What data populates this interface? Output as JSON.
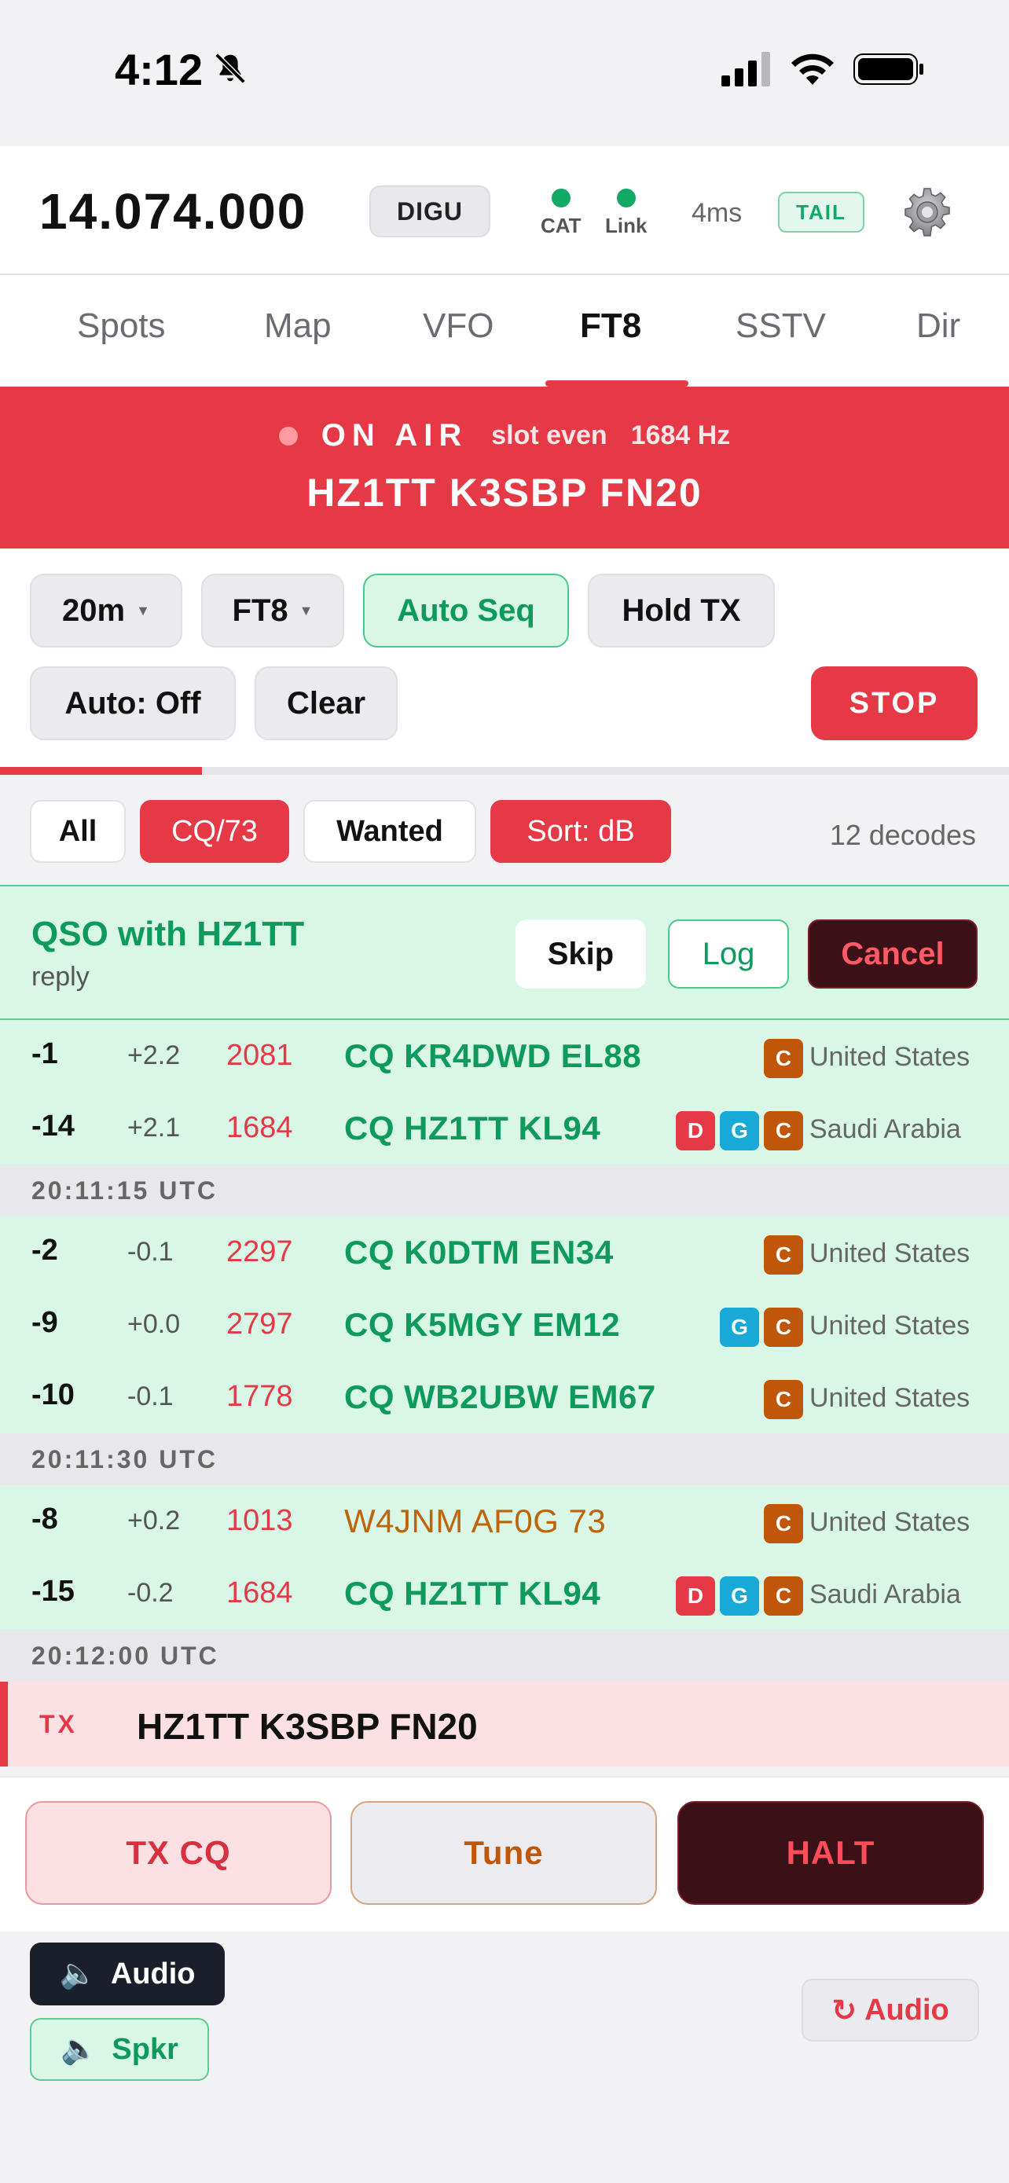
{
  "status_bar": {
    "time": "4:12"
  },
  "header": {
    "frequency": "14.074.000",
    "mode": "DIGU",
    "indicators": [
      {
        "label": "CAT",
        "color": "#12a866"
      },
      {
        "label": "Link",
        "color": "#12a866"
      }
    ],
    "latency": "4ms",
    "tail_label": "TAIL"
  },
  "tabs": [
    "Spots",
    "Map",
    "VFO",
    "FT8",
    "SSTV",
    "Dir"
  ],
  "active_tab": "FT8",
  "on_air": {
    "label": "ON AIR",
    "slot": "slot even",
    "offset": "1684 Hz",
    "message": "HZ1TT K3SBP FN20"
  },
  "controls": {
    "band": "20m",
    "protocol": "FT8",
    "auto_seq": "Auto Seq",
    "hold_tx": "Hold TX",
    "auto": "Auto: Off",
    "clear": "Clear",
    "stop": "STOP",
    "slot_progress": 0.2
  },
  "filters": {
    "all": "All",
    "cq73": "CQ/73",
    "wanted": "Wanted",
    "sort": "Sort: dB",
    "decode_count": "12 decodes"
  },
  "qso": {
    "title": "QSO with HZ1TT",
    "state": "reply",
    "skip": "Skip",
    "log": "Log",
    "cancel": "Cancel"
  },
  "decodes": [
    {
      "type": "row",
      "db": "-1",
      "dt": "+2.2",
      "hz": "2081",
      "msg": "CQ KR4DWD EL88",
      "cq": true,
      "badges": [
        "C"
      ],
      "country": "United States"
    },
    {
      "type": "row",
      "db": "-14",
      "dt": "+2.1",
      "hz": "1684",
      "msg": "CQ HZ1TT KL94",
      "cq": true,
      "badges": [
        "D",
        "G",
        "C"
      ],
      "country": "Saudi Arabia"
    },
    {
      "type": "sep",
      "time": "20:11:15 UTC"
    },
    {
      "type": "row",
      "db": "-2",
      "dt": "-0.1",
      "hz": "2297",
      "msg": "CQ K0DTM EN34",
      "cq": true,
      "badges": [
        "C"
      ],
      "country": "United States"
    },
    {
      "type": "row",
      "db": "-9",
      "dt": "+0.0",
      "hz": "2797",
      "msg": "CQ K5MGY EM12",
      "cq": true,
      "badges": [
        "G",
        "C"
      ],
      "country": "United States"
    },
    {
      "type": "row",
      "db": "-10",
      "dt": "-0.1",
      "hz": "1778",
      "msg": "CQ WB2UBW EM67",
      "cq": true,
      "badges": [
        "C"
      ],
      "country": "United States"
    },
    {
      "type": "sep",
      "time": "20:11:30 UTC"
    },
    {
      "type": "row",
      "db": "-8",
      "dt": "+0.2",
      "hz": "1013",
      "msg": "W4JNM AF0G 73",
      "cq": false,
      "badges": [
        "C"
      ],
      "country": "United States"
    },
    {
      "type": "row",
      "db": "-15",
      "dt": "-0.2",
      "hz": "1684",
      "msg": "CQ HZ1TT KL94",
      "cq": true,
      "badges": [
        "D",
        "G",
        "C"
      ],
      "country": "Saudi Arabia"
    },
    {
      "type": "sep",
      "time": "20:12:00 UTC"
    },
    {
      "type": "tx",
      "tag": "TX",
      "msg": "HZ1TT K3SBP FN20"
    }
  ],
  "actions": {
    "tx_cq": "TX CQ",
    "tune": "Tune",
    "halt": "HALT"
  },
  "audio": {
    "audio": "Audio",
    "speaker": "Spkr",
    "restart": "Audio"
  },
  "colors": {
    "accent_red": "#e63946",
    "accent_green": "#12a866",
    "badge_D": "#e63946",
    "badge_G": "#18a9d6",
    "badge_C": "#c0560a"
  }
}
